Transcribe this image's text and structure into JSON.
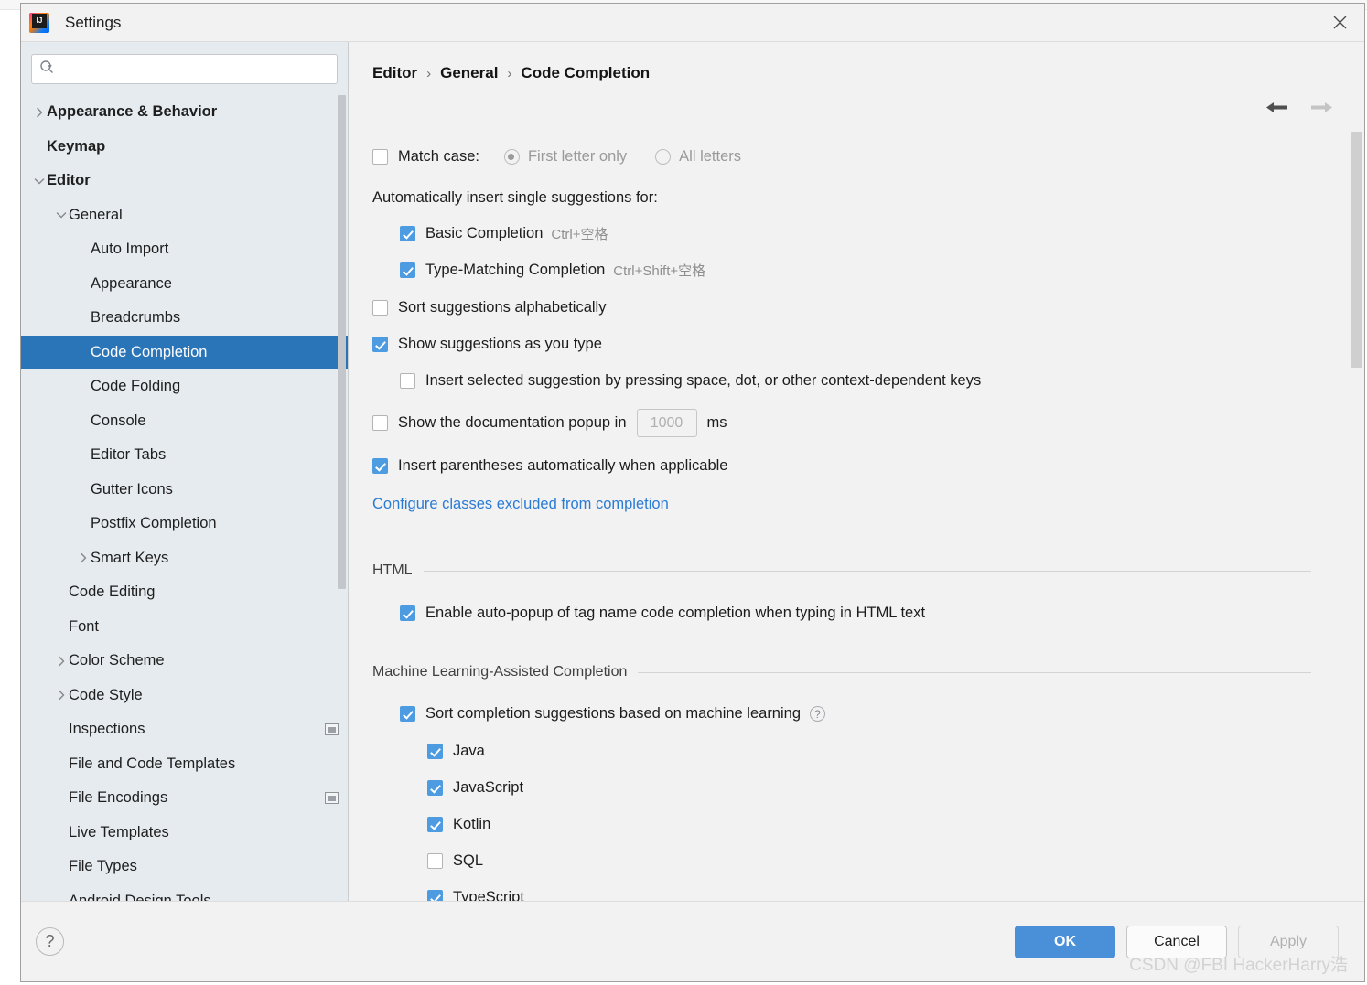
{
  "window": {
    "title": "Settings",
    "logo_icon": "intellij-idea-logo",
    "close_icon": "close-icon"
  },
  "sidebar": {
    "search": {
      "placeholder": "",
      "value": "",
      "icon": "search-icon",
      "dropdown_icon": "caret-down-icon"
    },
    "items": [
      {
        "label": "Appearance & Behavior",
        "indent": 0,
        "arrow": "chevron-right",
        "bold": true,
        "selected": false,
        "scope_icon": false
      },
      {
        "label": "Keymap",
        "indent": 0,
        "arrow": "none",
        "bold": true,
        "selected": false,
        "scope_icon": false
      },
      {
        "label": "Editor",
        "indent": 0,
        "arrow": "chevron-down",
        "bold": true,
        "selected": false,
        "scope_icon": false
      },
      {
        "label": "General",
        "indent": 1,
        "arrow": "chevron-down",
        "bold": false,
        "selected": false,
        "scope_icon": false
      },
      {
        "label": "Auto Import",
        "indent": 2,
        "arrow": "none",
        "bold": false,
        "selected": false,
        "scope_icon": false
      },
      {
        "label": "Appearance",
        "indent": 2,
        "arrow": "none",
        "bold": false,
        "selected": false,
        "scope_icon": false
      },
      {
        "label": "Breadcrumbs",
        "indent": 2,
        "arrow": "none",
        "bold": false,
        "selected": false,
        "scope_icon": false
      },
      {
        "label": "Code Completion",
        "indent": 2,
        "arrow": "none",
        "bold": false,
        "selected": true,
        "scope_icon": false
      },
      {
        "label": "Code Folding",
        "indent": 2,
        "arrow": "none",
        "bold": false,
        "selected": false,
        "scope_icon": false
      },
      {
        "label": "Console",
        "indent": 2,
        "arrow": "none",
        "bold": false,
        "selected": false,
        "scope_icon": false
      },
      {
        "label": "Editor Tabs",
        "indent": 2,
        "arrow": "none",
        "bold": false,
        "selected": false,
        "scope_icon": false
      },
      {
        "label": "Gutter Icons",
        "indent": 2,
        "arrow": "none",
        "bold": false,
        "selected": false,
        "scope_icon": false
      },
      {
        "label": "Postfix Completion",
        "indent": 2,
        "arrow": "none",
        "bold": false,
        "selected": false,
        "scope_icon": false
      },
      {
        "label": "Smart Keys",
        "indent": 2,
        "arrow": "chevron-right",
        "bold": false,
        "selected": false,
        "scope_icon": false
      },
      {
        "label": "Code Editing",
        "indent": 1,
        "arrow": "none",
        "bold": false,
        "selected": false,
        "scope_icon": false
      },
      {
        "label": "Font",
        "indent": 1,
        "arrow": "none",
        "bold": false,
        "selected": false,
        "scope_icon": false
      },
      {
        "label": "Color Scheme",
        "indent": 1,
        "arrow": "chevron-right",
        "bold": false,
        "selected": false,
        "scope_icon": false
      },
      {
        "label": "Code Style",
        "indent": 1,
        "arrow": "chevron-right",
        "bold": false,
        "selected": false,
        "scope_icon": false
      },
      {
        "label": "Inspections",
        "indent": 1,
        "arrow": "none",
        "bold": false,
        "selected": false,
        "scope_icon": true
      },
      {
        "label": "File and Code Templates",
        "indent": 1,
        "arrow": "none",
        "bold": false,
        "selected": false,
        "scope_icon": false
      },
      {
        "label": "File Encodings",
        "indent": 1,
        "arrow": "none",
        "bold": false,
        "selected": false,
        "scope_icon": true
      },
      {
        "label": "Live Templates",
        "indent": 1,
        "arrow": "none",
        "bold": false,
        "selected": false,
        "scope_icon": false
      },
      {
        "label": "File Types",
        "indent": 1,
        "arrow": "none",
        "bold": false,
        "selected": false,
        "scope_icon": false
      },
      {
        "label": "Android Design Tools",
        "indent": 1,
        "arrow": "none",
        "bold": false,
        "selected": false,
        "scope_icon": false
      }
    ]
  },
  "main": {
    "breadcrumb": [
      "Editor",
      "General",
      "Code Completion"
    ],
    "breadcrumb_separator": "›",
    "nav_back_icon": "arrow-left-icon",
    "nav_forward_icon": "arrow-right-icon",
    "match_case": {
      "label": "Match case:",
      "checked": false,
      "options": [
        {
          "label": "First letter only",
          "selected": true,
          "disabled": true
        },
        {
          "label": "All letters",
          "selected": false,
          "disabled": true
        }
      ]
    },
    "auto_insert_label": "Automatically insert single suggestions for:",
    "auto_insert_items": [
      {
        "label": "Basic Completion",
        "shortcut": "Ctrl+空格",
        "checked": true
      },
      {
        "label": "Type-Matching Completion",
        "shortcut": "Ctrl+Shift+空格",
        "checked": true
      }
    ],
    "sort_alphabetically": {
      "label": "Sort suggestions alphabetically",
      "checked": false
    },
    "show_as_you_type": {
      "label": "Show suggestions as you type",
      "checked": true
    },
    "insert_selected": {
      "label": "Insert selected suggestion by pressing space, dot, or other context-dependent keys",
      "checked": false
    },
    "doc_popup": {
      "label_before": "Show the documentation popup in",
      "value": "1000",
      "unit": "ms",
      "checked": false,
      "disabled": true
    },
    "insert_parentheses": {
      "label": "Insert parentheses automatically when applicable",
      "checked": true
    },
    "configure_link": "Configure classes excluded from completion",
    "html_section": {
      "title": "HTML",
      "auto_popup": {
        "label": "Enable auto-popup of tag name code completion when typing in HTML text",
        "checked": true
      }
    },
    "ml_section": {
      "title": "Machine Learning-Assisted Completion",
      "sort_ml": {
        "label": "Sort completion suggestions based on machine learning",
        "checked": true,
        "help_icon": "help-icon"
      },
      "languages": [
        {
          "label": "Java",
          "checked": true
        },
        {
          "label": "JavaScript",
          "checked": true
        },
        {
          "label": "Kotlin",
          "checked": true
        },
        {
          "label": "SQL",
          "checked": false
        },
        {
          "label": "TypeScript",
          "checked": true
        }
      ]
    }
  },
  "footer": {
    "help_icon": "help-icon",
    "ok_label": "OK",
    "cancel_label": "Cancel",
    "apply_label": "Apply",
    "apply_disabled": true
  },
  "watermark": "CSDN @FBI HackerHarry浩",
  "colors": {
    "selection_blue": "#2a74b8",
    "checkbox_blue": "#4d9be0",
    "primary_button": "#4a90d9",
    "link_blue": "#2a7bd4",
    "sidebar_bg": "#e6ebef",
    "panel_bg": "#f2f2f2"
  }
}
